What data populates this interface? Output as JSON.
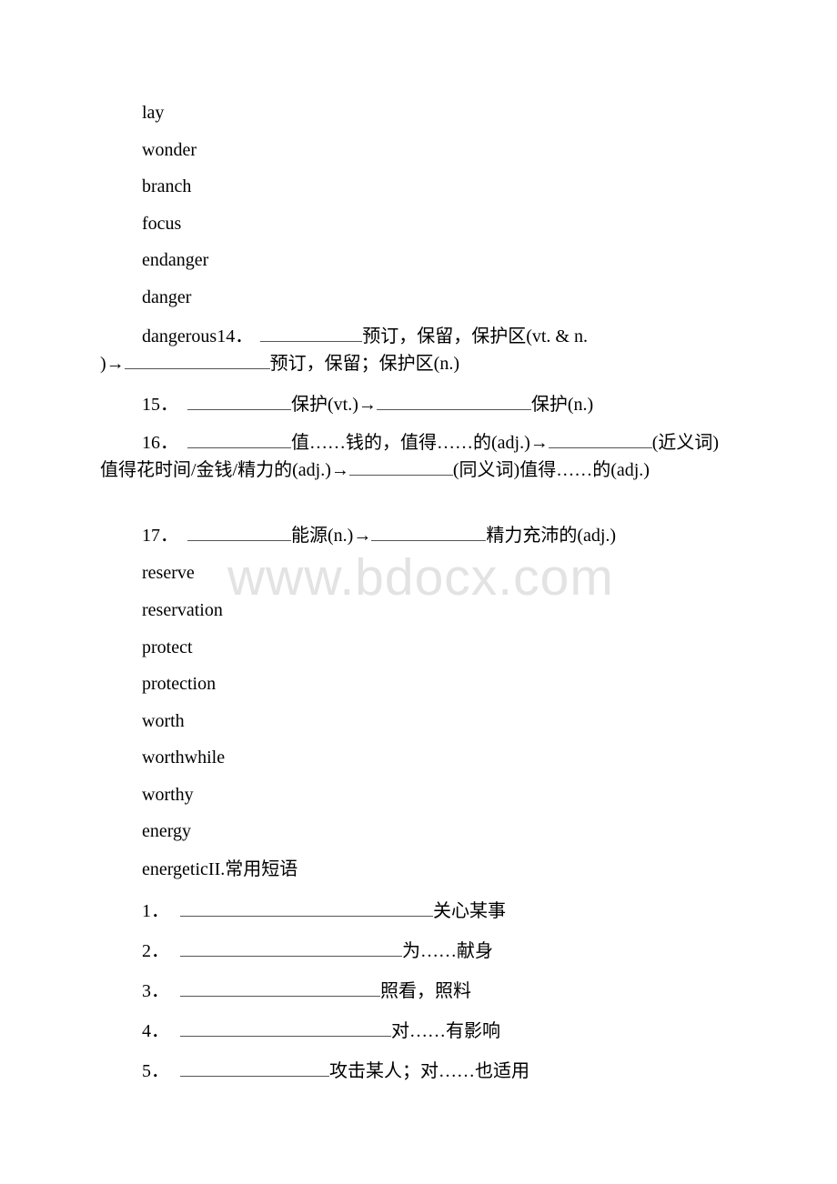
{
  "watermark": "www.bdocx.com",
  "word_list_a": [
    "lay",
    "wonder",
    "branch",
    "focus",
    "endanger",
    "danger"
  ],
  "item14": {
    "lead": "dangerous14．",
    "part1": "预订，保留，保护区(vt. & n.",
    "part2": ")→",
    "part3": "预订，保留；保护区(n.)"
  },
  "item15": {
    "number": "15．",
    "part1": "保护(vt.)→",
    "part2": "保护(n.)"
  },
  "item16": {
    "number": "16．",
    "part1": "值……钱的，值得……的(adj.)→",
    "part2": "(近义词)值得花时间/金钱/精力的(adj.)→",
    "part3": "(同义词)值得……的(adj.)"
  },
  "item17": {
    "number": "17．",
    "part1": "能源(n.)→",
    "part2": "精力充沛的(adj.)"
  },
  "word_list_b": [
    "reserve",
    "reservation",
    "protect",
    "protection",
    "worth",
    "worthwhile",
    "worthy",
    "energy"
  ],
  "section2_line": "energeticII.常用短语",
  "phrases": [
    {
      "number": "1．",
      "meaning": "关心某事"
    },
    {
      "number": "2．",
      "meaning": "为……献身"
    },
    {
      "number": "3．",
      "meaning": "照看，照料"
    },
    {
      "number": "4．",
      "meaning": "对……有影响"
    },
    {
      "number": "5．",
      "meaning": "攻击某人；对……也适用"
    }
  ]
}
